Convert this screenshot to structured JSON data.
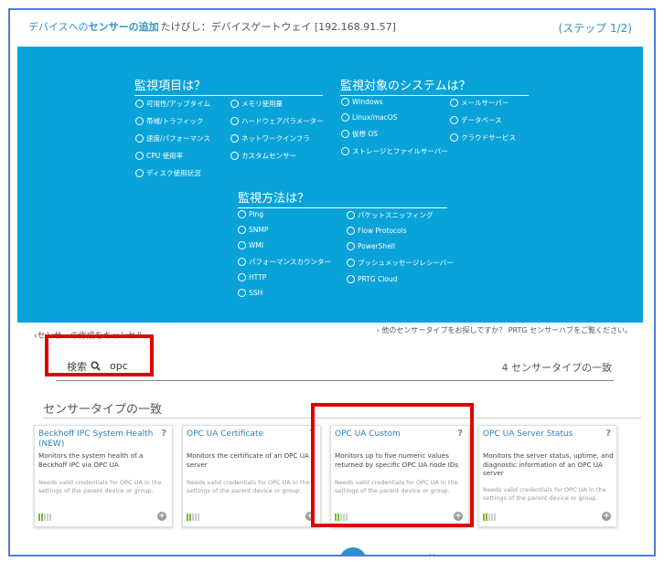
{
  "header": {
    "part1": "デバイスへの",
    "part2": "センサーの追加",
    "part3": " たけびし：デバイスゲートウェイ [192.168.91.57]",
    "step": "(ステップ 1/2)"
  },
  "panel": {
    "what_title": "監視項目は？",
    "what_col1": [
      "可用性/アップタイム",
      "帯域/トラフィック",
      "速度/パフォーマンス",
      "CPU 使用率",
      "ディスク使用状況"
    ],
    "what_col2": [
      "メモリ使用量",
      "ハードウェアパラメーター",
      "ネットワークインフラ",
      "カスタムセンサー"
    ],
    "sys_title": "監視対象のシステムは？",
    "sys_col1": [
      "Windows",
      "Linux/macOS",
      "仮想 OS",
      "ストレージとファイルサーバー"
    ],
    "sys_col2": [
      "メールサーバー",
      "データベース",
      "クラウドサービス"
    ],
    "how_title": "監視方法は？",
    "how_col1": [
      "Ping",
      "SNMP",
      "WMI",
      "パフォーマンスカウンター",
      "HTTP",
      "SSH"
    ],
    "how_col2": [
      "パケットスニッフィング",
      "Flow Protocols",
      "PowerShell",
      "プッシュメッセージレシーバー",
      "PRTG Cloud"
    ]
  },
  "cancel_link": "‹センサーの作成をキャンセル",
  "hub_link": "› 他のセンサータイプをお探しですか？ PRTG センサーハブをご覧ください。",
  "search": {
    "label": "検索",
    "value": "opc",
    "count": "4 センサータイプの一致"
  },
  "matches_title": "センサータイプの一致",
  "cards": [
    {
      "name": "Beckhoff IPC System Health (NEW)",
      "desc": "Monitors the system health of a Beckhoff IPC via OPC UA",
      "need": "Needs valid credentials for OPC UA in the settings of the parent device or group."
    },
    {
      "name": "OPC UA Certificate",
      "desc": "Monitors the certificate of an OPC UA server",
      "need": "Needs valid credentials for OPC UA in the settings of the parent device or group."
    },
    {
      "name": "OPC UA Custom",
      "desc": "Monitors up to five numeric values returned by specific OPC UA node IDs",
      "need": "Needs valid credentials for OPC UA in the settings of the parent device or group."
    },
    {
      "name": "OPC UA Server Status",
      "desc": "Monitors the server status, uptime, and diagnostic information of an OPC UA server",
      "need": "Needs valid credentials for OPC UA in the settings of the parent device or group."
    }
  ],
  "card_help": "?",
  "card_add": "+",
  "more_label": "他の",
  "colors": {
    "panel_bg": "#0aa3d9",
    "link_blue": "#2e7fbf",
    "highlight_red": "#e00000",
    "frame_blue": "#4f7fd6"
  }
}
